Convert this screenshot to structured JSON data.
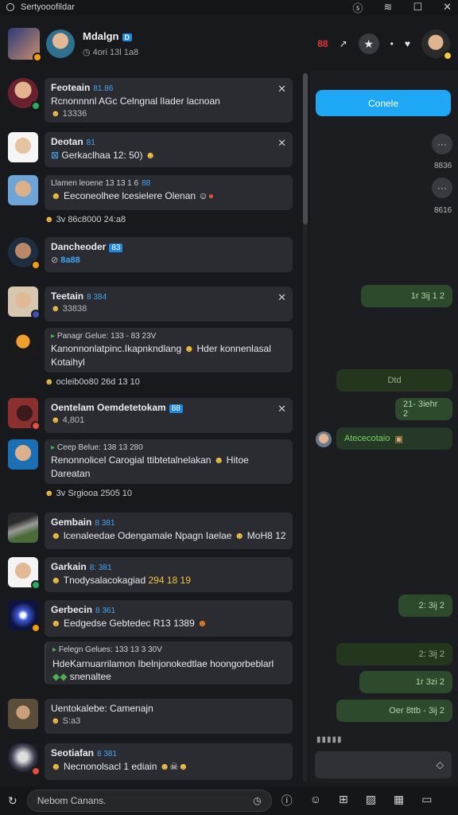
{
  "topbar": {
    "title": "Sertyooofildar"
  },
  "header": {
    "name": "Mdalgn",
    "tag": "D",
    "subtitle": "4ori 13l 1a8",
    "red_label": "88"
  },
  "items": [
    {
      "title": "Feoteain",
      "tag": "81.86",
      "message": "Rcnonnnnl AGc Celngnal lIader lacnoan",
      "sub": "13336",
      "avatar_color": "#8a2e3c"
    },
    {
      "title": "Deotan",
      "tag": "81",
      "message": "Gerkaclhaa 12: 50)",
      "avatar_color": "#e8d7c8"
    },
    {
      "title": "Llamen leoene 13 13 1 6",
      "tag": "88",
      "message": "Eeconeolhee lcesielere Olenan",
      "avatar_color": "#6fa4d6"
    },
    {
      "reactions": "3v 86c8000  24:a8"
    },
    {
      "title": "Dancheoder",
      "tag": "83",
      "sub": "8a88",
      "avatar_color": "#304a66"
    },
    {
      "title": "Teetain",
      "tag": "8 384",
      "sub": "33838",
      "avatar_color": "#c9a789"
    },
    {
      "reply_head": "Panagr Gelue: 133 - 83 23V",
      "message": "Kanonnonlatpinc.Ikapnkndlang",
      "message2": "Kotaihyl",
      "extra": "Hder konnenlasal"
    },
    {
      "reactions": "ocleib0o80  26d 13 10"
    },
    {
      "title": "Oentelam Oemdetetokam",
      "tag": "88",
      "sub": "4,801",
      "avatar_color": "#8b2f2f"
    },
    {
      "reply_head": "Ceep Belue: 138 13 280",
      "message": "Renonnolicel Carogial ttibtetalnelakan",
      "message2": "Dareatan",
      "extra": "Hitoe",
      "avatar_color": "#1b6fb5"
    },
    {
      "reactions": "3v Srgiooa  2505 10"
    },
    {
      "title": "Gembain",
      "tag": "8 381",
      "message": "lcenaleedae Odengamale Npagn Iaelae",
      "extra": "MoH8 12",
      "avatar_color": "#4a6b3a"
    },
    {
      "title": "Garkain",
      "tag": "8: 381",
      "message": "Tnodysalacokagiad",
      "extra": "294 18 19",
      "avatar_color": "#d8c2a8"
    },
    {
      "title": "Gerbecin",
      "tag": "8 361",
      "message": "Eedgedse Gebtedec R13 1389",
      "avatar_color": "#1c2a6b"
    },
    {
      "reply_head": "Felegn Gelues: 133 13 3 30V",
      "message": "HdeKarnuarrilamon Ibelnjonokedtlae hoongorbeblarl",
      "message2": "snenaltee"
    },
    {
      "title": "Uentokalebe: Camenajn",
      "sub": "S:a3",
      "avatar_color": "#5a4d3a"
    },
    {
      "title": "Seotiafan",
      "tag": "8 381",
      "message": "Necnonolsacl 1 ediain",
      "avatar_color": "#444458"
    }
  ],
  "right": {
    "primary_button": "Conele",
    "label1": "8836",
    "label2": "8616",
    "bubbles": [
      "1r 3ij 1 2",
      "Dtd",
      "21- 3iehr 2",
      "Atececotaio",
      "2: 3ij 2",
      "2: 3ij 2",
      "1r 3zi 2",
      "Oer 8ttb - 3ij 2"
    ]
  },
  "bottom": {
    "input_placeholder": "Nebom Canans."
  }
}
